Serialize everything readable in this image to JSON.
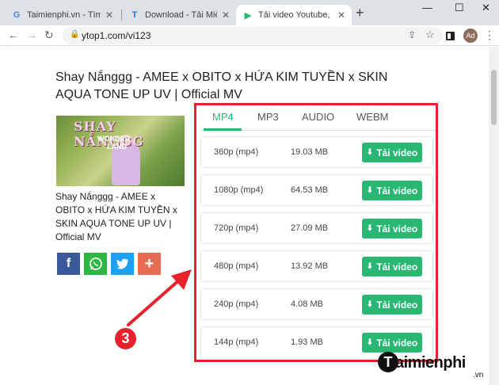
{
  "browser": {
    "tabs": [
      {
        "title": "Taimienphi.vn - Tìm trên Go",
        "favicon": "G"
      },
      {
        "title": "Download - Tải Miễn Phí VN",
        "favicon": "T"
      },
      {
        "title": "Tải video Youtube, chuyển",
        "favicon": "▶",
        "active": true
      }
    ],
    "new_tab": "+",
    "url": "ytop1.com/vi123",
    "avatar_initials": "Ad"
  },
  "page": {
    "title": "Shay Nắnggg - AMEE x OBITO x HỨA KIM TUYỀN x SKIN AQUA TONE UP UV | Official MV",
    "thumbnail_text": {
      "line1": "SHAY NẮNGGG",
      "line2": "WONDER",
      "line3": "LAND"
    },
    "video_title": "Shay Nắnggg - AMEE x OBITO x HỨA KIM TUYỀN x SKIN AQUA TONE UP UV | Official MV"
  },
  "share": {
    "facebook": "f",
    "whatsapp": "✆",
    "twitter": "🐦",
    "plus": "+"
  },
  "formats": {
    "tabs": [
      "MP4",
      "MP3",
      "AUDIO",
      "WEBM"
    ],
    "active": "MP4",
    "rows": [
      {
        "quality": "360p (mp4)",
        "size": "19.03 MB",
        "button": "Tải video"
      },
      {
        "quality": "1080p (mp4)",
        "size": "64.53 MB",
        "button": "Tải video"
      },
      {
        "quality": "720p (mp4)",
        "size": "27.09 MB",
        "button": "Tải video"
      },
      {
        "quality": "480p (mp4)",
        "size": "13.92 MB",
        "button": "Tải video"
      },
      {
        "quality": "240p (mp4)",
        "size": "4.08 MB",
        "button": "Tải video"
      },
      {
        "quality": "144p (mp4)",
        "size": "1.93 MB",
        "button": "Tải video"
      }
    ]
  },
  "annotation": {
    "step_number": "3",
    "color": "#e8222c"
  },
  "watermark": {
    "letter": "T",
    "text": "aimienphi",
    "suffix": ".vn"
  },
  "colors": {
    "accent": "#2bb673",
    "facebook": "#3b5998",
    "whatsapp": "#2cb742",
    "twitter": "#1da1f2",
    "plus": "#e86c53"
  }
}
